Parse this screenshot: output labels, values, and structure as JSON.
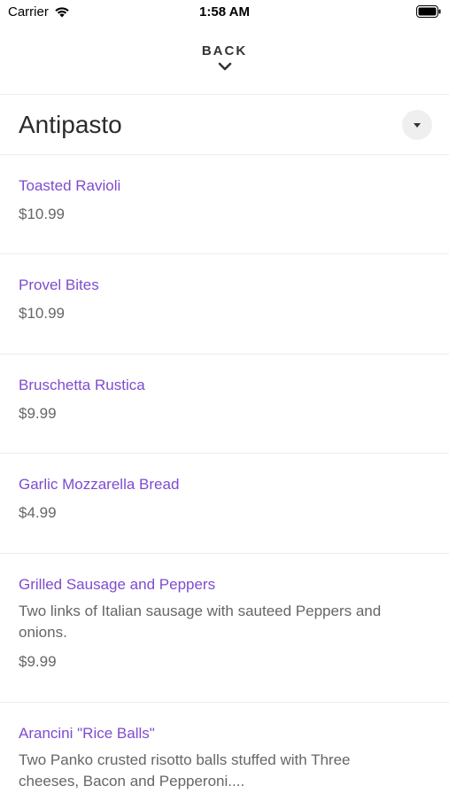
{
  "status_bar": {
    "carrier": "Carrier",
    "time": "1:58 AM",
    "wifi_icon": "wifi-icon",
    "battery_icon": "battery-icon"
  },
  "nav": {
    "back_label": "BACK",
    "chevron_icon": "chevron-down-icon"
  },
  "category": {
    "title": "Antipasto",
    "dropdown_icon": "caret-down-icon"
  },
  "colors": {
    "item_name": "#7e4bd0",
    "text": "#666666",
    "title": "#2b2b2b",
    "divider": "#ececec"
  },
  "items": [
    {
      "name": "Toasted Ravioli",
      "price": "$10.99"
    },
    {
      "name": "Provel Bites",
      "price": "$10.99"
    },
    {
      "name": "Bruschetta Rustica",
      "price": "$9.99"
    },
    {
      "name": "Garlic Mozzarella Bread",
      "price": "$4.99"
    },
    {
      "name": "Grilled Sausage and Peppers",
      "description": "Two links of Italian sausage with sauteed Peppers and onions.",
      "price": "$9.99"
    },
    {
      "name": "Arancini \"Rice Balls\"",
      "description": "Two Panko crusted risotto balls stuffed with Three cheeses, Bacon and Pepperoni...."
    }
  ]
}
